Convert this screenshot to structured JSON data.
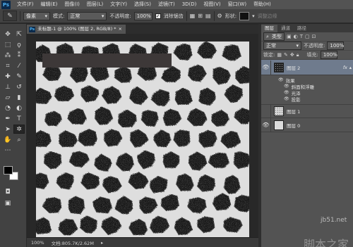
{
  "app": {
    "logo": "Ps"
  },
  "menu": [
    "文件(F)",
    "编辑(E)",
    "图像(I)",
    "图层(L)",
    "文字(Y)",
    "选择(S)",
    "滤镜(T)",
    "3D(D)",
    "视图(V)",
    "窗口(W)",
    "帮助(H)"
  ],
  "options": {
    "preset_icon": "brush-tool-icon",
    "sample_value": "像素",
    "mode_label": "模式:",
    "mode_value": "正常",
    "opacity_label": "不透明度:",
    "opacity_value": "100%",
    "antialias_label": "消除锯齿",
    "shape_label": "形状:",
    "edges_label": "调整边缘"
  },
  "document": {
    "tab_title": "未标题-1 @ 100% (图层 2, RGB/8) *",
    "zoom": "100%",
    "doc_info": "文档:805.7K/2.62M"
  },
  "layers_panel": {
    "tabs": [
      "图层",
      "通道",
      "路径"
    ],
    "kind_value": "类型",
    "blend_mode": "正常",
    "opacity_label": "不透明度:",
    "opacity_value": "100%",
    "lock_label": "锁定:",
    "fill_label": "填充:",
    "fill_value": "100%",
    "layers": [
      {
        "name": "图层 2",
        "fx": "fx",
        "effects_label": "效果",
        "effects": [
          "斜面和浮雕",
          "光泽",
          "投影"
        ]
      },
      {
        "name": "图层 1"
      },
      {
        "name": "图层 0"
      }
    ]
  },
  "watermark": {
    "url": "jb51.net",
    "text": "脚本之家"
  },
  "colors": {
    "foreground": "#000000",
    "background": "#ffffff",
    "selection": "#6f7b8d"
  }
}
